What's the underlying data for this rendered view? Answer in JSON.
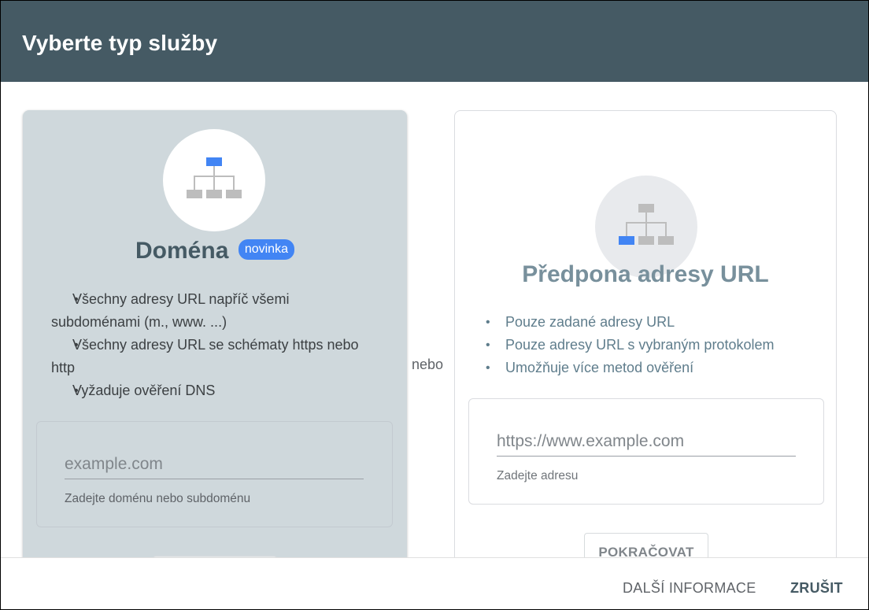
{
  "dialog": {
    "title": "Vyberte typ služby",
    "separator": "nebo"
  },
  "domain_card": {
    "title": "Doména",
    "badge": "novinka",
    "icon": "sitemap-icon",
    "bullets": [
      "Všechny adresy URL napříč všemi subdoménami (m., www. ...)",
      "Všechny adresy URL se schématy https nebo http",
      "Vyžaduje ověření DNS"
    ],
    "input_placeholder": "example.com",
    "input_value": "",
    "helper": "Zadejte doménu nebo subdoménu"
  },
  "url_prefix_card": {
    "title": "Předpona adresy URL",
    "icon": "sitemap-icon",
    "bullets": [
      "Pouze zadané adresy URL",
      "Pouze adresy URL s vybraným protokolem",
      "Umožňuje více metod ověření"
    ],
    "input_placeholder": "https://www.example.com",
    "input_value": "",
    "helper": "Zadejte adresu",
    "continue_label": "POKRAČOVAT"
  },
  "footer": {
    "info_label": "DALŠÍ INFORMACE",
    "cancel_label": "ZRUŠIT"
  },
  "colors": {
    "header_bg": "#455a64",
    "selected_card_bg": "#cfd8dc",
    "accent_blue": "#4285f4",
    "node_grey": "#bdbdbd"
  }
}
